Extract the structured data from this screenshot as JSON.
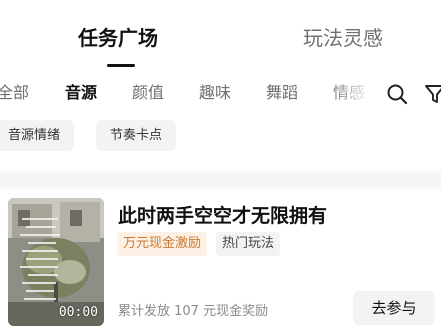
{
  "top_tabs": {
    "active": "任务广场",
    "inactive": "玩法灵感"
  },
  "categories": {
    "items": [
      "全部",
      "音源",
      "颜值",
      "趣味",
      "舞蹈",
      "情感"
    ],
    "selected": "音源"
  },
  "icons": {
    "search": "search-icon",
    "filter": "filter-icon"
  },
  "sub_tags": [
    "音源情绪",
    "节奏卡点"
  ],
  "task": {
    "title": "此时两手空空才无限拥有",
    "reward_badge": "万元现金激励",
    "hot_badge": "热门玩法",
    "payout_text": "累计发放 107 元现金奖励",
    "join_label": "去参与",
    "duration": "00:00"
  },
  "colors": {
    "reward_text": "#c97a33",
    "reward_bg": "#fdf0e4",
    "tag_bg": "#f3f3f3"
  }
}
